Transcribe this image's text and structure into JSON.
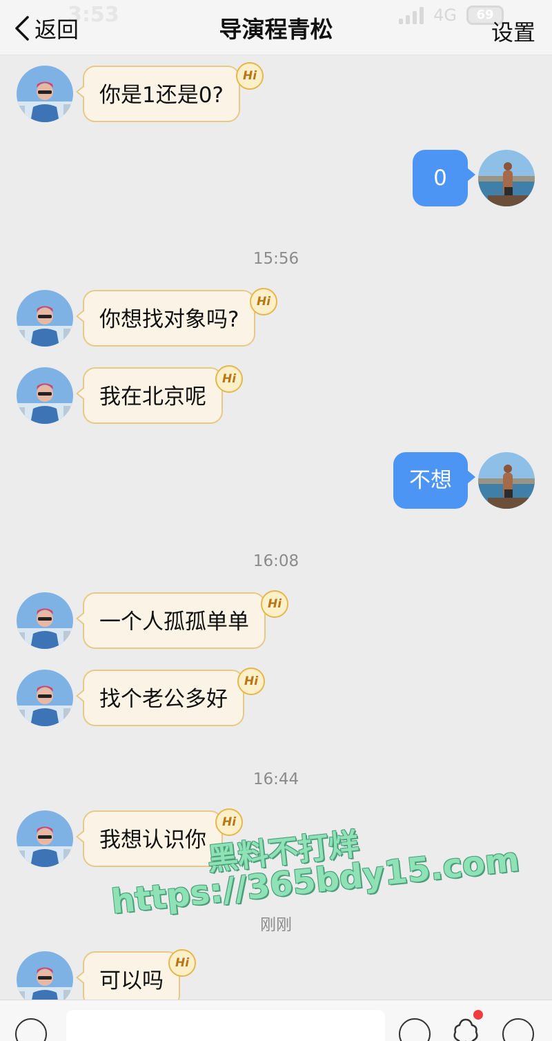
{
  "status_bar": {
    "time": "3:53",
    "network": "4G",
    "battery": "69"
  },
  "header": {
    "back_label": "返回",
    "title": "导演程青松",
    "settings_label": "设置"
  },
  "badge_label": "Hi",
  "messages": [
    {
      "side": "in",
      "text": "你是1还是0?"
    },
    {
      "side": "out",
      "text": "0"
    },
    {
      "side": "in",
      "text": "你想找对象吗?"
    },
    {
      "side": "in",
      "text": "我在北京呢"
    },
    {
      "side": "out",
      "text": "不想"
    },
    {
      "side": "in",
      "text": "一个人孤孤单单"
    },
    {
      "side": "in",
      "text": "找个老公多好"
    },
    {
      "side": "in",
      "text": "我想认识你"
    },
    {
      "side": "in",
      "text": "可以吗"
    }
  ],
  "timestamps": [
    "15:56",
    "16:08",
    "16:44",
    "刚刚"
  ],
  "watermark": {
    "line1": "黑料不打烊",
    "line2": "https://365bdy15.com"
  },
  "colors": {
    "outgoing_bubble": "#4d95f4",
    "incoming_bubble": "#fbf4e6",
    "incoming_border": "#e7c987",
    "background": "#ececec"
  },
  "icons": [
    "back-chevron-icon",
    "voice-icon",
    "emoji-icon",
    "favorite-icon",
    "plus-icon"
  ]
}
